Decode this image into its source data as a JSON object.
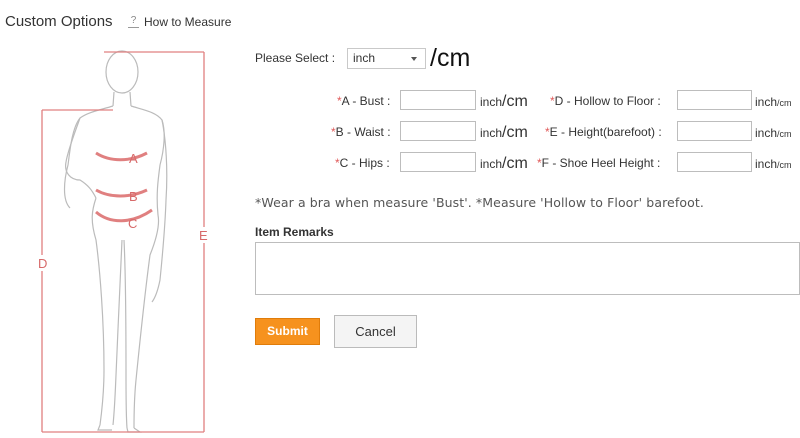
{
  "header": {
    "title": "Custom Options",
    "help_icon": "question-mark",
    "help_link": "How to Measure"
  },
  "figure": {
    "labels": {
      "a": "A",
      "b": "B",
      "c": "C",
      "d": "D",
      "e": "E"
    },
    "measure_color": "#e08080"
  },
  "unit_select": {
    "label": "Please Select :",
    "value": "inch",
    "suffix": "/cm"
  },
  "fields": [
    {
      "required": "*",
      "label": "A - Bust :",
      "unit_inch": "inch",
      "unit_cm": "/cm"
    },
    {
      "required": "*",
      "label": "B - Waist :",
      "unit_inch": "inch",
      "unit_cm": "/cm"
    },
    {
      "required": "*",
      "label": "C - Hips :",
      "unit_inch": "inch",
      "unit_cm": "/cm"
    },
    {
      "required": "*",
      "label": "D - Hollow to Floor :",
      "unit_inch": "inch",
      "unit_cm": "/cm"
    },
    {
      "required": "*",
      "label": "E - Height(barefoot) :",
      "unit_inch": "inch",
      "unit_cm": "/cm"
    },
    {
      "required": "*",
      "label": "F - Shoe Heel Height :",
      "unit_inch": "inch",
      "unit_cm": "/cm"
    }
  ],
  "note": "*Wear a bra when measure 'Bust'. *Measure 'Hollow to Floor' barefoot.",
  "remarks": {
    "label": "Item Remarks",
    "value": ""
  },
  "buttons": {
    "submit": "Submit",
    "cancel": "Cancel"
  },
  "colors": {
    "accent": "#f6921e",
    "required": "#e05a5a",
    "measure": "#e08080"
  }
}
